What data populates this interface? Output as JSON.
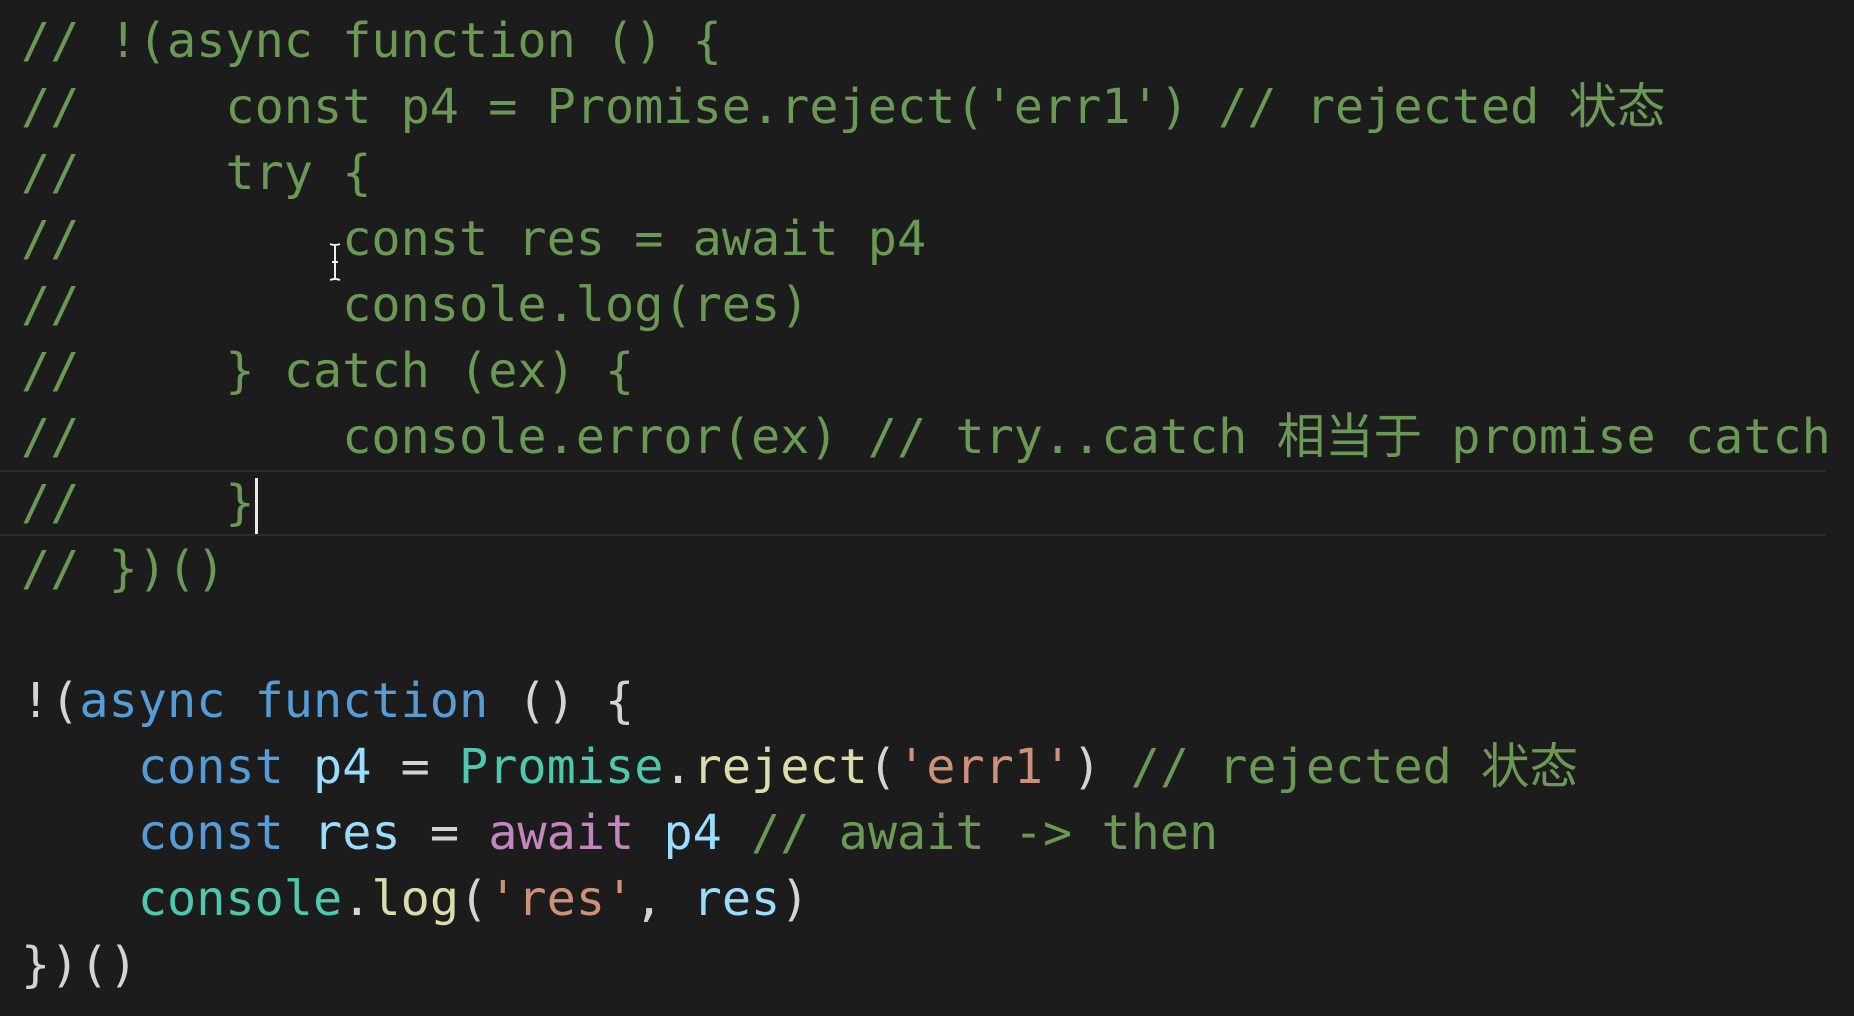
{
  "editor": {
    "current_line": 7,
    "colors": {
      "background": "#1c1c1c",
      "comment": "#6a9955",
      "keyword": "#569cd6",
      "variable": "#9cdcfe",
      "class": "#4ec9b0",
      "function": "#dcdcaa",
      "string": "#ce9178",
      "control": "#c586c0"
    },
    "lines": [
      [
        {
          "t": "// !(async function () {",
          "c": "cm"
        }
      ],
      [
        {
          "t": "//     const p4 = Promise.reject('err1') // rejected 状态",
          "c": "cm"
        }
      ],
      [
        {
          "t": "//     try {",
          "c": "cm"
        }
      ],
      [
        {
          "t": "//         const res = await p4",
          "c": "cm"
        }
      ],
      [
        {
          "t": "//         console.log(res)",
          "c": "cm"
        }
      ],
      [
        {
          "t": "//     } catch (ex) {",
          "c": "cm"
        }
      ],
      [
        {
          "t": "//         console.error(ex) // try..catch 相当于 promise catch",
          "c": "cm"
        }
      ],
      [
        {
          "t": "//     }",
          "c": "cm"
        }
      ],
      [
        {
          "t": "// })()",
          "c": "cm"
        }
      ],
      [],
      [
        {
          "t": "!(",
          "c": "df"
        },
        {
          "t": "async",
          "c": "kw"
        },
        {
          "t": " ",
          "c": "df"
        },
        {
          "t": "function",
          "c": "kw"
        },
        {
          "t": " () {",
          "c": "df"
        }
      ],
      [
        {
          "t": "    ",
          "c": "df"
        },
        {
          "t": "const",
          "c": "kw"
        },
        {
          "t": " ",
          "c": "df"
        },
        {
          "t": "p4",
          "c": "vr"
        },
        {
          "t": " = ",
          "c": "df"
        },
        {
          "t": "Promise",
          "c": "cl"
        },
        {
          "t": ".",
          "c": "df"
        },
        {
          "t": "reject",
          "c": "fn"
        },
        {
          "t": "(",
          "c": "df"
        },
        {
          "t": "'err1'",
          "c": "st"
        },
        {
          "t": ") ",
          "c": "df"
        },
        {
          "t": "// rejected 状态",
          "c": "cm"
        }
      ],
      [
        {
          "t": "    ",
          "c": "df"
        },
        {
          "t": "const",
          "c": "kw"
        },
        {
          "t": " ",
          "c": "df"
        },
        {
          "t": "res",
          "c": "vr"
        },
        {
          "t": " = ",
          "c": "df"
        },
        {
          "t": "await",
          "c": "ctl"
        },
        {
          "t": " ",
          "c": "df"
        },
        {
          "t": "p4",
          "c": "vr"
        },
        {
          "t": " ",
          "c": "df"
        },
        {
          "t": "// await -> then",
          "c": "cm"
        }
      ],
      [
        {
          "t": "    ",
          "c": "df"
        },
        {
          "t": "console",
          "c": "cl"
        },
        {
          "t": ".",
          "c": "df"
        },
        {
          "t": "log",
          "c": "fn"
        },
        {
          "t": "(",
          "c": "df"
        },
        {
          "t": "'res'",
          "c": "st"
        },
        {
          "t": ", ",
          "c": "df"
        },
        {
          "t": "res",
          "c": "vr"
        },
        {
          "t": ")",
          "c": "df"
        }
      ],
      [
        {
          "t": "})()",
          "c": "df"
        }
      ]
    ]
  }
}
